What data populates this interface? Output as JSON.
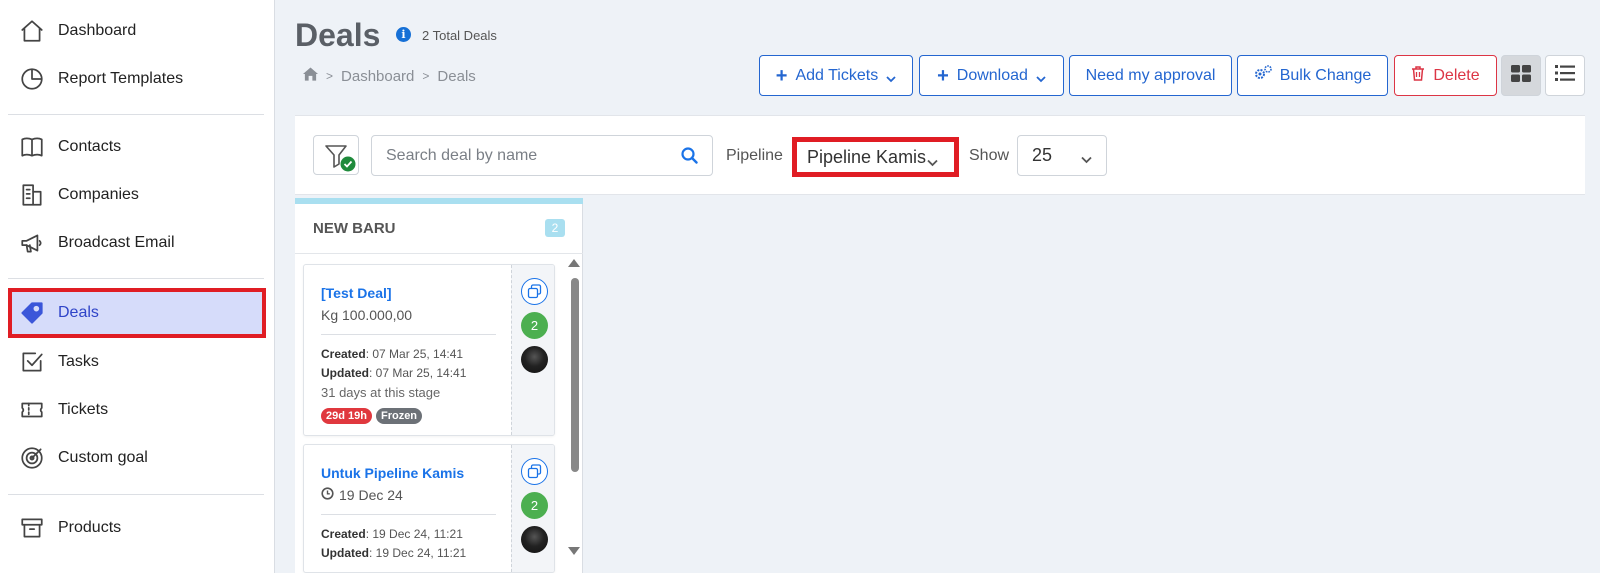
{
  "sidebar": {
    "items": [
      {
        "label": "Dashboard",
        "icon": "home-icon"
      },
      {
        "label": "Report Templates",
        "icon": "pie-chart-icon"
      },
      {
        "label": "Contacts",
        "icon": "address-book-icon"
      },
      {
        "label": "Companies",
        "icon": "building-icon"
      },
      {
        "label": "Broadcast Email",
        "icon": "megaphone-icon"
      },
      {
        "label": "Deals",
        "icon": "tag-icon",
        "active": true
      },
      {
        "label": "Tasks",
        "icon": "check-square-icon"
      },
      {
        "label": "Tickets",
        "icon": "ticket-icon"
      },
      {
        "label": "Custom goal",
        "icon": "target-icon"
      },
      {
        "label": "Products",
        "icon": "archive-icon"
      }
    ]
  },
  "header": {
    "title": "Deals",
    "total_deals": "2 Total Deals",
    "breadcrumb": [
      "Dashboard",
      "Deals"
    ]
  },
  "toolbar": {
    "add_tickets": "Add Tickets",
    "download": "Download",
    "need_approval": "Need my approval",
    "bulk_change": "Bulk Change",
    "delete": "Delete"
  },
  "filters": {
    "search_placeholder": "Search deal by name",
    "pipeline_label": "Pipeline",
    "pipeline_value": "Pipeline Kamis",
    "show_label": "Show",
    "show_value": "25"
  },
  "column": {
    "title": "NEW BARU",
    "count": "2",
    "cards": [
      {
        "title": "[Test Deal]",
        "value": "Kg 100.000,00",
        "created_label": "Created",
        "created": ": 07 Mar 25, 14:41",
        "updated_label": "Updated",
        "updated": ": 07 Mar 25, 14:41",
        "stage": "31 days at this stage",
        "badge_time": "29d 19h",
        "badge_status": "Frozen",
        "count": "2"
      },
      {
        "title": "Untuk Pipeline Kamis",
        "value": "19 Dec 24",
        "created_label": "Created",
        "created": ": 19 Dec 24, 11:21",
        "updated_label": "Updated",
        "updated": ": 19 Dec 24, 11:21",
        "count": "2"
      }
    ]
  },
  "colors": {
    "accent": "#2466d0",
    "highlight": "#e01d24",
    "delete": "#dc3545",
    "success": "#4caf50"
  }
}
